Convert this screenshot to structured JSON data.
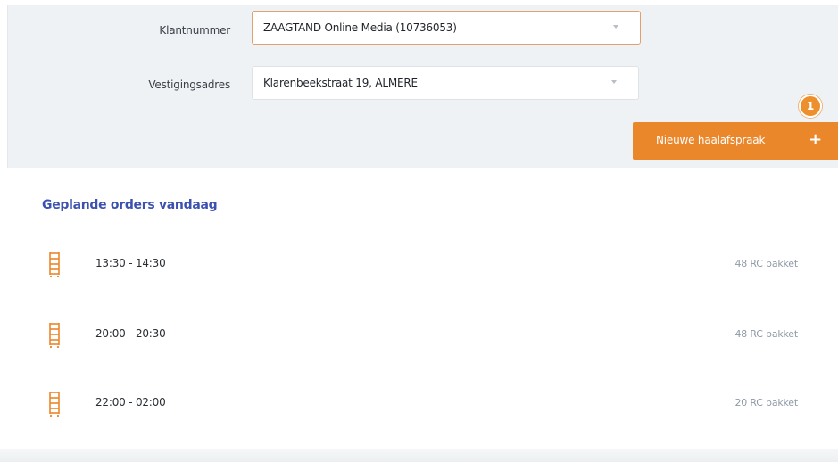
{
  "filters": {
    "customer_number": {
      "label": "Klantnummer",
      "value": "ZAAGTAND Online Media (10736053)"
    },
    "branch_address": {
      "label": "Vestigingsadres",
      "value": "Klarenbeekstraat 19, ALMERE"
    }
  },
  "actions": {
    "new_pickup": {
      "label": "Nieuwe haalafspraak",
      "icon": "plus-icon"
    },
    "step_badge": "1"
  },
  "orders": {
    "title": "Geplande orders vandaag",
    "items": [
      {
        "time": "13:30 - 14:30",
        "quantity": "48 RC pakket",
        "icon": "roll-container-icon"
      },
      {
        "time": "20:00 - 20:30",
        "quantity": "48 RC pakket",
        "icon": "roll-container-icon"
      },
      {
        "time": "22:00 - 02:00",
        "quantity": "20 RC pakket",
        "icon": "roll-container-icon"
      }
    ]
  },
  "colors": {
    "accent": "#e9872a",
    "title": "#3d52b0",
    "panel": "#eef2f5"
  }
}
